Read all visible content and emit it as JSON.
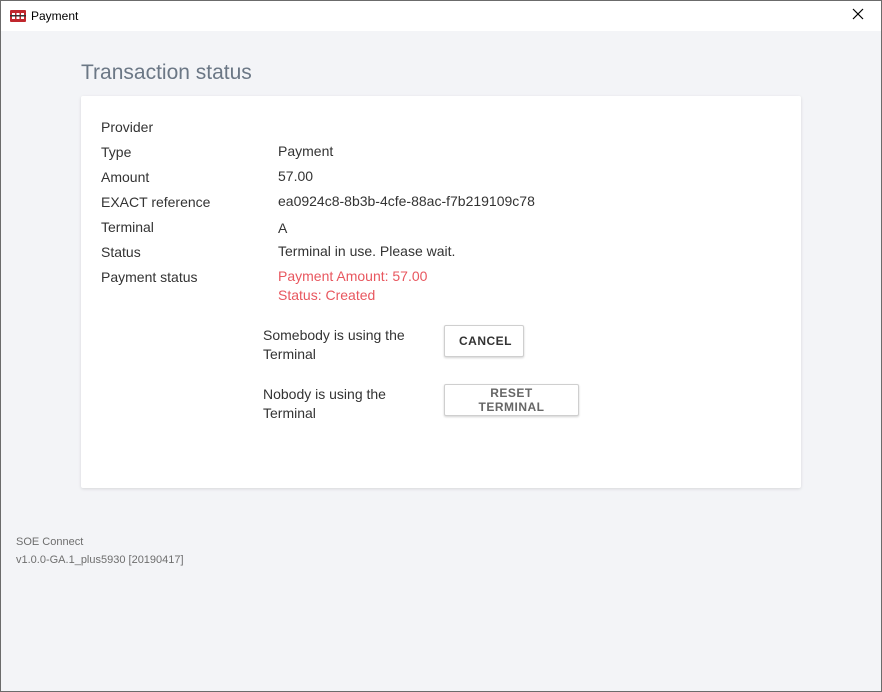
{
  "window": {
    "title": "Payment",
    "app_icon": "soe-app-icon",
    "close_icon": "close-icon"
  },
  "page": {
    "title": "Transaction status"
  },
  "details": {
    "rows": [
      {
        "label": "Provider",
        "value": ""
      },
      {
        "label": "Type",
        "value": "Payment"
      },
      {
        "label": "Amount",
        "value": "57.00"
      },
      {
        "label": "EXACT reference",
        "value": "ea0924c8-8b3b-4cfe-88ac-f7b219109c78"
      },
      {
        "label": "Terminal",
        "value": "A"
      },
      {
        "label": "Status",
        "value": "Terminal in use. Please wait."
      }
    ],
    "payment_status": {
      "label": "Payment status",
      "amount_line": "Payment Amount: 57.00",
      "status_line": "Status: Created",
      "color": "#e8575f"
    }
  },
  "actions": {
    "somebody_text": "Somebody is using the Terminal",
    "cancel_label": "CANCEL",
    "nobody_text": "Nobody is using the Terminal",
    "reset_label": "RESET TERMINAL"
  },
  "footer": {
    "app_name": "SOE Connect",
    "version": "v1.0.0-GA.1_plus5930 [20190417]"
  }
}
